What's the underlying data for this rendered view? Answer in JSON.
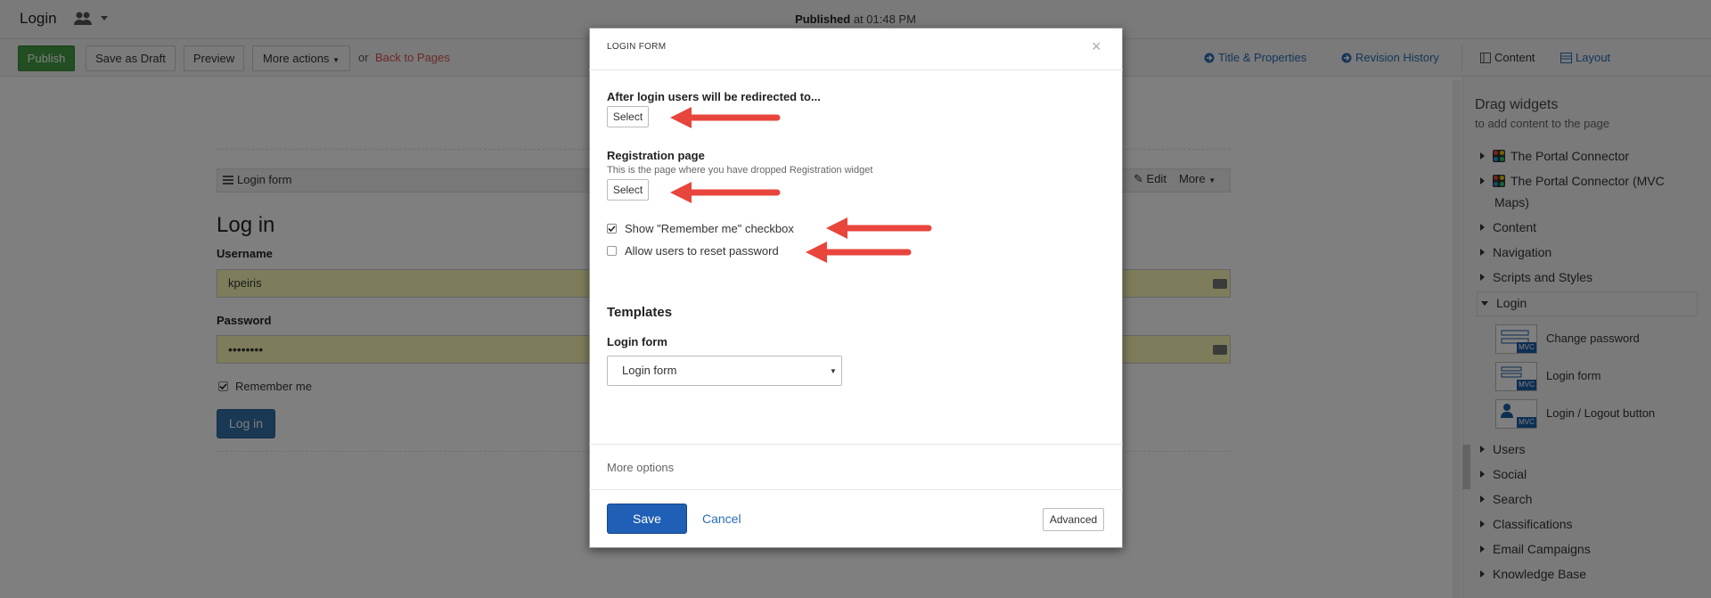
{
  "header": {
    "page_name": "Login",
    "published_bold": "Published",
    "published_time": "at 01:48 PM"
  },
  "toolbar": {
    "publish": "Publish",
    "save_draft": "Save as Draft",
    "preview": "Preview",
    "more_actions": "More actions",
    "or": "or",
    "back_to_pages": "Back to Pages",
    "title_properties": "Title & Properties",
    "revision_history": "Revision History",
    "content": "Content",
    "layout": "Layout"
  },
  "page": {
    "widget_title": "Login form",
    "widget_edit": "Edit",
    "widget_more": "More",
    "heading": "Log in",
    "username_label": "Username",
    "username_value": "kpeiris",
    "password_label": "Password",
    "password_value": "••••••••",
    "remember_me": "Remember me",
    "login_button": "Log in"
  },
  "sidebar": {
    "title": "Drag widgets",
    "subtitle": "to add content to the page",
    "items": [
      {
        "label": "The Portal Connector",
        "expanded": false,
        "icon": "portal-icon"
      },
      {
        "label": "The Portal Connector (MVC",
        "label2": "Maps)",
        "expanded": false,
        "icon": "portal-icon"
      },
      {
        "label": "Content",
        "expanded": false
      },
      {
        "label": "Navigation",
        "expanded": false
      },
      {
        "label": "Scripts and Styles",
        "expanded": false
      },
      {
        "label": "Login",
        "expanded": true
      },
      {
        "label": "Users",
        "expanded": false
      },
      {
        "label": "Social",
        "expanded": false
      },
      {
        "label": "Search",
        "expanded": false
      },
      {
        "label": "Classifications",
        "expanded": false
      },
      {
        "label": "Email Campaigns",
        "expanded": false
      },
      {
        "label": "Knowledge Base",
        "expanded": false
      }
    ],
    "login_widgets": [
      {
        "label": "Change password",
        "tag": "MVC"
      },
      {
        "label": "Login form",
        "tag": "MVC"
      },
      {
        "label": "Login / Logout button",
        "tag": "MVC"
      }
    ]
  },
  "modal": {
    "title": "LOGIN FORM",
    "close": "×",
    "redirect_label": "After login users will be redirected to...",
    "select": "Select",
    "registration_label": "Registration page",
    "registration_desc": "This is the page where you have dropped Registration widget",
    "show_remember": "Show \"Remember me\" checkbox",
    "show_remember_checked": true,
    "allow_reset": "Allow users to reset password",
    "allow_reset_checked": false,
    "templates_heading": "Templates",
    "template_label": "Login form",
    "template_value": "Login form",
    "more_options": "More options",
    "save": "Save",
    "cancel": "Cancel",
    "advanced": "Advanced"
  },
  "colors": {
    "publish_green": "#449d44",
    "link_blue": "#2a6db5",
    "back_red": "#d9534f",
    "save_blue": "#1f5fb5",
    "arrow_red": "#e8453c",
    "autofill_yellow": "#fbfab8"
  }
}
